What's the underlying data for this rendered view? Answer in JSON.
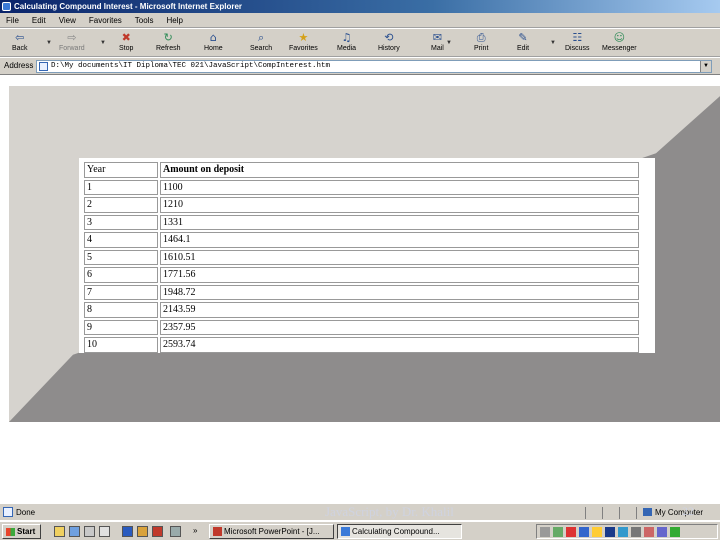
{
  "window": {
    "title": "Calculating Compound Interest - Microsoft Internet Explorer"
  },
  "menu": [
    "File",
    "Edit",
    "View",
    "Favorites",
    "Tools",
    "Help"
  ],
  "toolbar": {
    "back": "Back",
    "forward": "Forward",
    "stop": "Stop",
    "refresh": "Refresh",
    "home": "Home",
    "search": "Search",
    "favorites": "Favorites",
    "media": "Media",
    "history": "History",
    "mail": "Mail",
    "print": "Print",
    "edit": "Edit",
    "discuss": "Discuss",
    "messenger": "Messenger"
  },
  "address": {
    "label": "Address",
    "value": "D:\\My documents\\IT Diploma\\TEC 021\\JavaScript\\CompInterest.htm"
  },
  "table": {
    "headers": [
      "Year",
      "Amount on deposit"
    ],
    "rows": [
      [
        "1",
        "1100"
      ],
      [
        "2",
        "1210"
      ],
      [
        "3",
        "1331"
      ],
      [
        "4",
        "1464.1"
      ],
      [
        "5",
        "1610.51"
      ],
      [
        "6",
        "1771.56"
      ],
      [
        "7",
        "1948.72"
      ],
      [
        "8",
        "2143.59"
      ],
      [
        "9",
        "2357.95"
      ],
      [
        "10",
        "2593.74"
      ]
    ]
  },
  "status": {
    "text": "Done",
    "footer_credit": "JavaScript, by Dr. Khalil",
    "zone": "My Computer",
    "page_number": "22"
  },
  "taskbar": {
    "start": "Start",
    "tasks": [
      "Microsoft PowerPoint - [J...",
      "Calculating Compound..."
    ]
  }
}
